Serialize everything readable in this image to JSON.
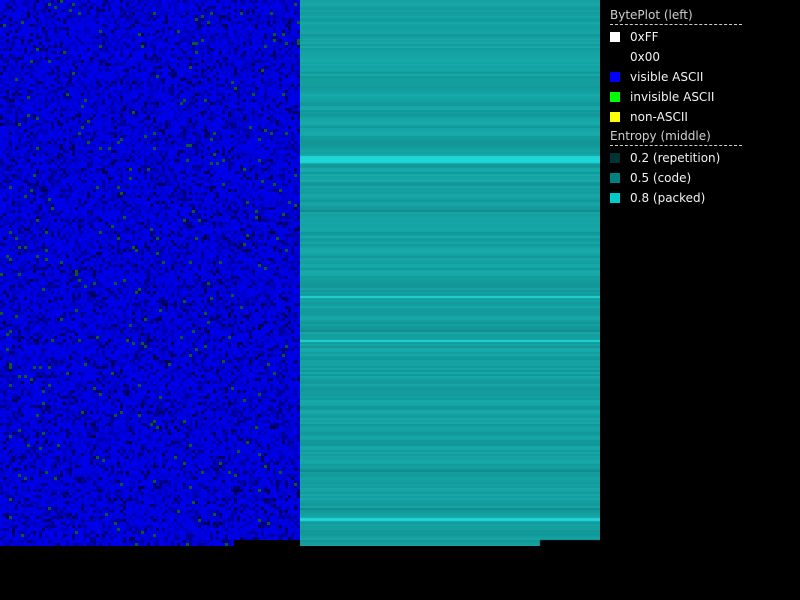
{
  "byteplot": {
    "base_color": "#0000e6",
    "dark_color": "#000060",
    "dot_color": "#0a5a2a"
  },
  "entropy": {
    "base_color": "#17a3a3",
    "bright_color": "#1fd6d6"
  },
  "legend": {
    "byteplot_header": "BytePlot (left)",
    "byteplot_items": [
      {
        "label": "0xFF",
        "color": "#ffffff"
      },
      {
        "label": "0x00",
        "color": "#000000"
      },
      {
        "label": "visible ASCII",
        "color": "#0000ff"
      },
      {
        "label": "invisible ASCII",
        "color": "#00ff00"
      },
      {
        "label": "non-ASCII",
        "color": "#ffff00"
      }
    ],
    "entropy_header": "Entropy (middle)",
    "entropy_items": [
      {
        "label": "0.2 (repetition)",
        "color": "#003333"
      },
      {
        "label": "0.5 (code)",
        "color": "#008080"
      },
      {
        "label": "0.8 (packed)",
        "color": "#00cccc"
      }
    ]
  }
}
